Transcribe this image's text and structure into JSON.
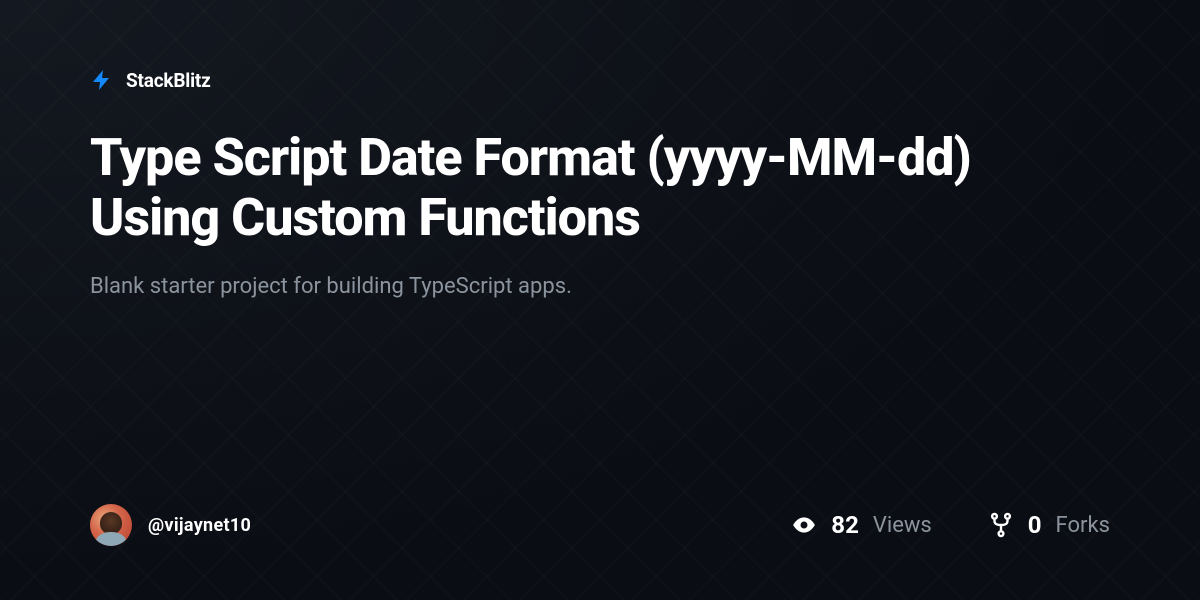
{
  "brand": {
    "name": "StackBlitz",
    "icon_color": "#1389fd"
  },
  "project": {
    "title": "Type Script Date Format (yyyy-MM-dd) Using Custom Functions",
    "description": "Blank starter project for building TypeScript apps."
  },
  "author": {
    "username": "@vijaynet10"
  },
  "stats": {
    "views": {
      "count": "82",
      "label": "Views"
    },
    "forks": {
      "count": "0",
      "label": "Forks"
    }
  }
}
